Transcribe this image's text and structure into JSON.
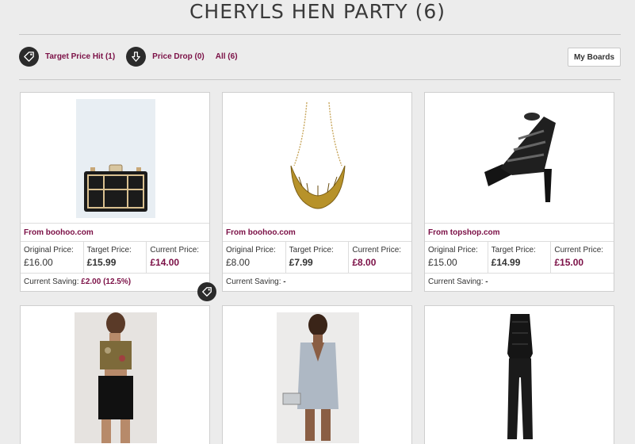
{
  "header": {
    "title": "CHERYLS HEN PARTY (6)"
  },
  "filters": [
    {
      "label": "Target Price Hit (1)",
      "icon": "price-tag-icon"
    },
    {
      "label": "Price Drop (0)",
      "icon": "arrow-down-icon"
    },
    {
      "label": "All (6)"
    }
  ],
  "toolbar": {
    "my_boards_label": "My Boards"
  },
  "price_labels": {
    "original": "Original Price:",
    "target": "Target Price:",
    "current": "Current Price:",
    "saving": "Current Saving:"
  },
  "products": [
    {
      "source": "From boohoo.com",
      "original": "£16.00",
      "target": "£15.99",
      "current": "£14.00",
      "saving": "£2.00 (12.5%)",
      "image": "black-clutch-bag"
    },
    {
      "source": "From boohoo.com",
      "original": "£8.00",
      "target": "£7.99",
      "current": "£8.00",
      "saving": "-",
      "image": "gold-collar-necklace"
    },
    {
      "source": "From topshop.com",
      "original": "£15.00",
      "target": "£14.99",
      "current": "£15.00",
      "saving": "-",
      "image": "black-platform-sandals"
    },
    {
      "image": "brocade-crop-top-outfit"
    },
    {
      "image": "grey-plunge-playsuit"
    },
    {
      "image": "black-lace-jumpsuit"
    }
  ],
  "colors": {
    "accent": "#7b1046",
    "icon_bg": "#2b2b2b",
    "background": "#ececec"
  }
}
